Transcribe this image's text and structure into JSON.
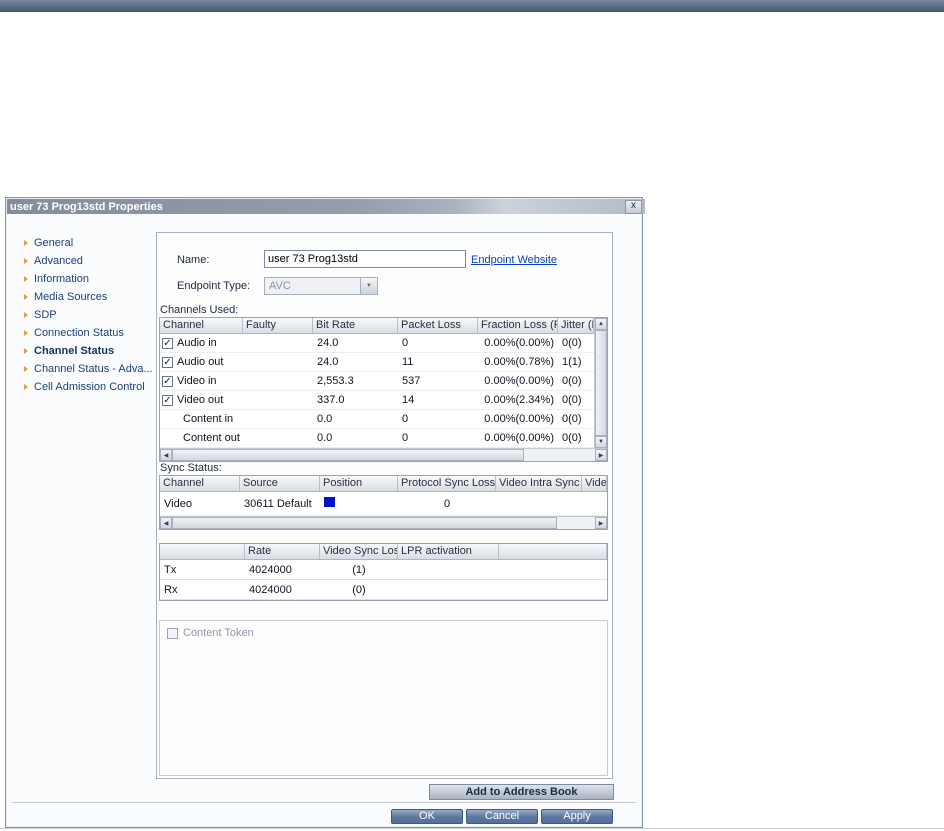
{
  "window": {
    "title": "user 73 Prog13std Properties"
  },
  "icons": {
    "close": "x",
    "up": "▲",
    "down": "▼",
    "left": "◀",
    "right": "▶"
  },
  "sidebar": {
    "items": [
      {
        "label": "General",
        "selected": false
      },
      {
        "label": "Advanced",
        "selected": false
      },
      {
        "label": "Information",
        "selected": false
      },
      {
        "label": "Media Sources",
        "selected": false
      },
      {
        "label": "SDP",
        "selected": false
      },
      {
        "label": "Connection Status",
        "selected": false
      },
      {
        "label": "Channel Status",
        "selected": true
      },
      {
        "label": "Channel Status - Adva...",
        "selected": false
      },
      {
        "label": "Cell Admission Control",
        "selected": false
      }
    ]
  },
  "form": {
    "name_label": "Name:",
    "name_value": "user 73 Prog13std",
    "website_link": "Endpoint Website",
    "type_label": "Endpoint Type:",
    "type_value": "AVC"
  },
  "channels": {
    "title": "Channels Used:",
    "columns": [
      "Channel",
      "Faulty",
      "Bit Rate",
      "Packet Loss",
      "Fraction Loss (Pe",
      "Jitter (P"
    ],
    "rows": [
      {
        "checked": true,
        "channel": "Audio in",
        "faulty": "",
        "bit_rate": "24.0",
        "packet_loss": "0",
        "fraction_loss": "0.00%(0.00%)",
        "jitter": "0(0)"
      },
      {
        "checked": true,
        "channel": "Audio out",
        "faulty": "",
        "bit_rate": "24.0",
        "packet_loss": "11",
        "fraction_loss": "0.00%(0.78%)",
        "jitter": "1(1)"
      },
      {
        "checked": true,
        "channel": "Video in",
        "faulty": "",
        "bit_rate": "2,553.3",
        "packet_loss": "537",
        "fraction_loss": "0.00%(0.00%)",
        "jitter": "0(0)"
      },
      {
        "checked": true,
        "channel": "Video out",
        "faulty": "",
        "bit_rate": "337.0",
        "packet_loss": "14",
        "fraction_loss": "0.00%(2.34%)",
        "jitter": "0(0)"
      },
      {
        "checked": false,
        "channel": "Content in",
        "faulty": "",
        "bit_rate": "0.0",
        "packet_loss": "0",
        "fraction_loss": "0.00%(0.00%)",
        "jitter": "0(0)"
      },
      {
        "checked": false,
        "channel": "Content out",
        "faulty": "",
        "bit_rate": "0.0",
        "packet_loss": "0",
        "fraction_loss": "0.00%(0.00%)",
        "jitter": "0(0)"
      }
    ]
  },
  "sync": {
    "title": "Sync Status:",
    "columns": [
      "Channel",
      "Source",
      "Position",
      "Protocol Sync Loss",
      "Video Intra Sync",
      "Video R"
    ],
    "row": {
      "channel": "Video",
      "source": "30611 Default",
      "position_color": "#0013cf",
      "protocol_sync_loss": "0",
      "video_intra_sync": "",
      "video_r": ""
    }
  },
  "rates": {
    "columns": [
      "",
      "Rate",
      "Video Sync Loss",
      "LPR activation"
    ],
    "rows": [
      {
        "label": "Tx",
        "rate": "4024000",
        "video_sync_loss": "(1)",
        "lpr_activation": ""
      },
      {
        "label": "Rx",
        "rate": "4024000",
        "video_sync_loss": "(0)",
        "lpr_activation": ""
      }
    ]
  },
  "content_token": {
    "label": "Content Token",
    "checked": false
  },
  "actions": {
    "add_to_address_book": "Add to Address Book",
    "ok": "OK",
    "cancel": "Cancel",
    "apply": "Apply"
  }
}
